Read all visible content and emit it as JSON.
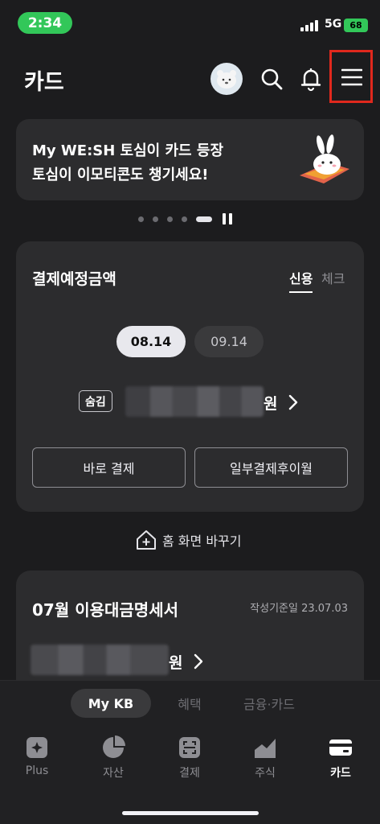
{
  "status_bar": {
    "time": "2:34",
    "network": "5G",
    "battery": "68"
  },
  "header": {
    "title": "카드"
  },
  "banner": {
    "line1": "My WE:SH 토심이 카드 등장",
    "line2": "토심이 이모티콘도 챙기세요!"
  },
  "payment": {
    "title": "결제예정금액",
    "tabs": [
      "신용",
      "체크"
    ],
    "dates": [
      "08.14",
      "09.14"
    ],
    "hide_label": "숨김",
    "currency": "원",
    "buttons": {
      "pay_now": "바로 결제",
      "partial_pay": "일부결제후이월"
    }
  },
  "home_change": "홈 화면 바꾸기",
  "statement": {
    "title": "07월 이용대금명세서",
    "date": "작성기준일 23.07.03",
    "currency": "원"
  },
  "segments": [
    "My KB",
    "혜택",
    "금융·카드"
  ],
  "tabs": [
    {
      "label": "Plus",
      "icon": "plus-sparkle-icon"
    },
    {
      "label": "자산",
      "icon": "pie-chart-icon"
    },
    {
      "label": "결제",
      "icon": "scan-icon"
    },
    {
      "label": "주식",
      "icon": "chart-icon"
    },
    {
      "label": "카드",
      "icon": "card-icon"
    }
  ]
}
